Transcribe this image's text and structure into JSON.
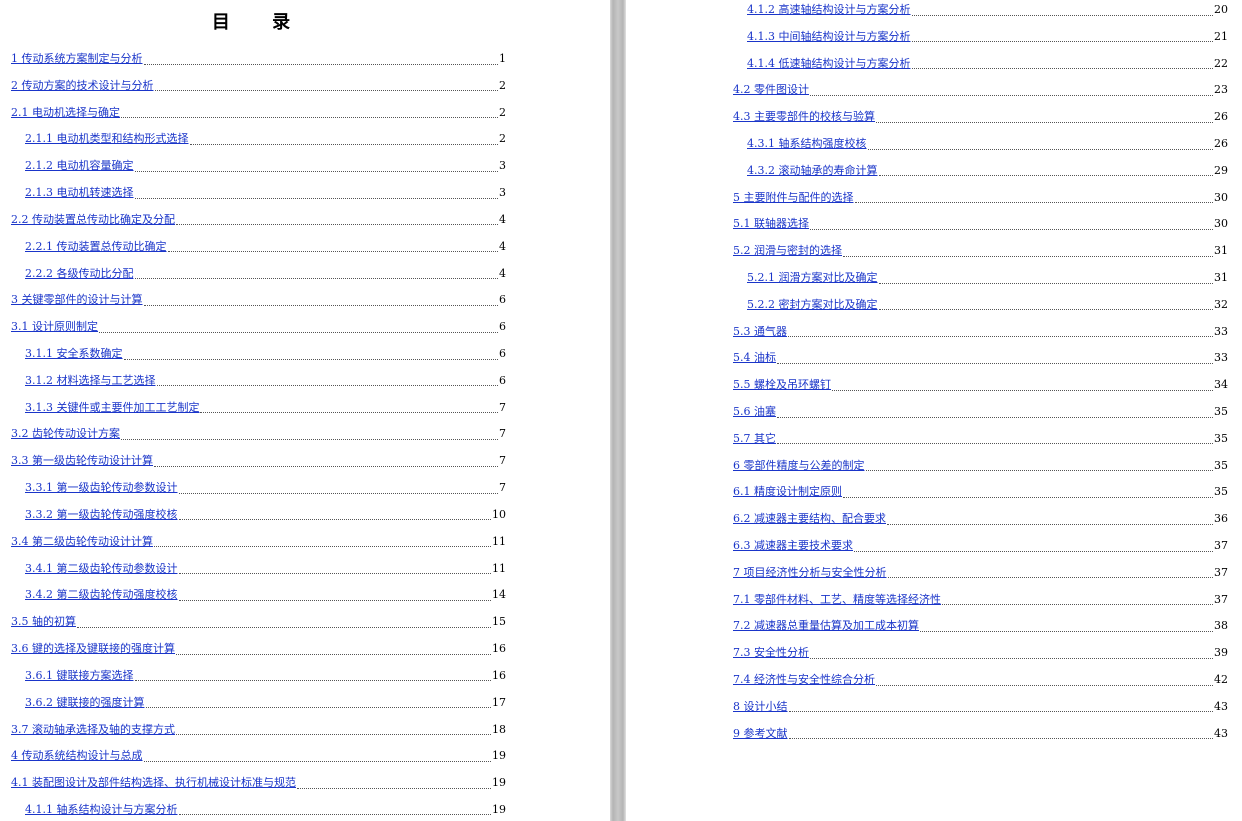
{
  "toc_title": "目 录",
  "left_entries": [
    {
      "text": "1 传动系统方案制定与分析",
      "page": "1",
      "level": 1
    },
    {
      "text": "2 传动方案的技术设计与分析",
      "page": "2",
      "level": 1
    },
    {
      "text": "2.1 电动机选择与确定",
      "page": "2",
      "level": 1
    },
    {
      "text": "2.1.1 电动机类型和结构形式选择",
      "page": "2",
      "level": 2
    },
    {
      "text": "2.1.2 电动机容量确定",
      "page": "3",
      "level": 2
    },
    {
      "text": "2.1.3 电动机转速选择",
      "page": "3",
      "level": 2
    },
    {
      "text": "2.2 传动装置总传动比确定及分配",
      "page": "4",
      "level": 1
    },
    {
      "text": "2.2.1 传动装置总传动比确定",
      "page": "4",
      "level": 2
    },
    {
      "text": "2.2.2 各级传动比分配",
      "page": "4",
      "level": 2
    },
    {
      "text": "3 关键零部件的设计与计算",
      "page": "6",
      "level": 1
    },
    {
      "text": "3.1 设计原则制定",
      "page": "6",
      "level": 1
    },
    {
      "text": "3.1.1 安全系数确定",
      "page": "6",
      "level": 2
    },
    {
      "text": "3.1.2 材料选择与工艺选择",
      "page": "6",
      "level": 2
    },
    {
      "text": "3.1.3 关键件或主要件加工工艺制定",
      "page": "7",
      "level": 2
    },
    {
      "text": "3.2 齿轮传动设计方案",
      "page": "7",
      "level": 1
    },
    {
      "text": "3.3 第一级齿轮传动设计计算",
      "page": "7",
      "level": 1
    },
    {
      "text": "3.3.1 第一级齿轮传动参数设计",
      "page": "7",
      "level": 2
    },
    {
      "text": "3.3.2 第一级齿轮传动强度校核",
      "page": "10",
      "level": 2
    },
    {
      "text": "3.4 第二级齿轮传动设计计算",
      "page": "11",
      "level": 1
    },
    {
      "text": "3.4.1 第二级齿轮传动参数设计",
      "page": "11",
      "level": 2
    },
    {
      "text": "3.4.2 第二级齿轮传动强度校核",
      "page": "14",
      "level": 2
    },
    {
      "text": "3.5 轴的初算",
      "page": "15",
      "level": 1
    },
    {
      "text": "3.6 键的选择及键联接的强度计算",
      "page": "16",
      "level": 1
    },
    {
      "text": "3.6.1 键联接方案选择",
      "page": "16",
      "level": 2
    },
    {
      "text": "3.6.2 键联接的强度计算",
      "page": "17",
      "level": 2
    },
    {
      "text": "3.7 滚动轴承选择及轴的支撑方式",
      "page": "18",
      "level": 1
    },
    {
      "text": "4 传动系统结构设计与总成",
      "page": "19",
      "level": 1
    },
    {
      "text": "4.1 装配图设计及部件结构选择、执行机械设计标准与规范",
      "page": "19",
      "level": 1
    },
    {
      "text": "4.1.1 轴系结构设计与方案分析",
      "page": "19",
      "level": 2
    }
  ],
  "right_entries": [
    {
      "text": "4.1.2 高速轴结构设计与方案分析",
      "page": "20",
      "level": 2
    },
    {
      "text": "4.1.3 中间轴结构设计与方案分析",
      "page": "21",
      "level": 2
    },
    {
      "text": "4.1.4 低速轴结构设计与方案分析",
      "page": "22",
      "level": 2
    },
    {
      "text": "4.2 零件图设计",
      "page": "23",
      "level": 1
    },
    {
      "text": "4.3 主要零部件的校核与验算",
      "page": "26",
      "level": 1
    },
    {
      "text": "4.3.1 轴系结构强度校核",
      "page": "26",
      "level": 2
    },
    {
      "text": "4.3.2 滚动轴承的寿命计算",
      "page": "29",
      "level": 2
    },
    {
      "text": "5 主要附件与配件的选择",
      "page": "30",
      "level": 1
    },
    {
      "text": "5.1 联轴器选择",
      "page": "30",
      "level": 1
    },
    {
      "text": "5.2 润滑与密封的选择",
      "page": "31",
      "level": 1
    },
    {
      "text": "5.2.1 润滑方案对比及确定",
      "page": "31",
      "level": 2
    },
    {
      "text": "5.2.2 密封方案对比及确定",
      "page": "32",
      "level": 2
    },
    {
      "text": "5.3 通气器",
      "page": "33",
      "level": 1
    },
    {
      "text": "5.4 油标",
      "page": "33",
      "level": 1
    },
    {
      "text": "5.5 螺栓及吊环螺钉",
      "page": "34",
      "level": 1
    },
    {
      "text": "5.6 油塞",
      "page": "35",
      "level": 1
    },
    {
      "text": "5.7 其它",
      "page": "35",
      "level": 1
    },
    {
      "text": "6 零部件精度与公差的制定",
      "page": "35",
      "level": 1
    },
    {
      "text": "6.1 精度设计制定原则",
      "page": "35",
      "level": 1
    },
    {
      "text": "6.2 减速器主要结构、配合要求",
      "page": "36",
      "level": 1
    },
    {
      "text": "6.3 减速器主要技术要求",
      "page": "37",
      "level": 1
    },
    {
      "text": "7 项目经济性分析与安全性分析",
      "page": "37",
      "level": 1
    },
    {
      "text": "7.1 零部件材料、工艺、精度等选择经济性",
      "page": "37",
      "level": 1
    },
    {
      "text": "7.2 减速器总重量估算及加工成本初算",
      "page": "38",
      "level": 1
    },
    {
      "text": "7.3 安全性分析",
      "page": "39",
      "level": 1
    },
    {
      "text": "7.4 经济性与安全性综合分析",
      "page": "42",
      "level": 1
    },
    {
      "text": "8 设计小结",
      "page": "43",
      "level": 1
    },
    {
      "text": "9 参考文献",
      "page": "43",
      "level": 1
    }
  ]
}
